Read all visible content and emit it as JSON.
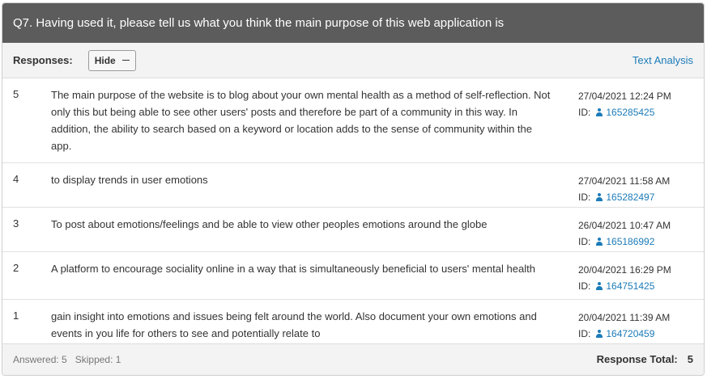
{
  "question": {
    "title": "Q7. Having used it, please tell us what you think the main purpose of this web application is"
  },
  "toolbar": {
    "responses_label": "Responses:",
    "hide_label": "Hide",
    "text_analysis_label": "Text Analysis"
  },
  "responses": [
    {
      "num": "5",
      "text": "The main purpose of the website is to blog about your own mental health as a method of self-reflection. Not only this but being able to see other users' posts and therefore be part of a community in this way. In addition, the ability to search based on a keyword or location adds to the sense of community within the app.",
      "datetime": "27/04/2021 12:24 PM",
      "id_label": "ID:",
      "id": "165285425"
    },
    {
      "num": "4",
      "text": "to display trends in user emotions",
      "datetime": "27/04/2021 11:58 AM",
      "id_label": "ID:",
      "id": "165282497"
    },
    {
      "num": "3",
      "text": "To post about emotions/feelings and be able to view other peoples emotions around the globe",
      "datetime": "26/04/2021 10:47 AM",
      "id_label": "ID:",
      "id": "165186992"
    },
    {
      "num": "2",
      "text": "A platform to encourage sociality online in a way that is simultaneously beneficial to users' mental health",
      "datetime": "20/04/2021 16:29 PM",
      "id_label": "ID:",
      "id": "164751425"
    },
    {
      "num": "1",
      "text": "gain insight into emotions and issues being felt around the world. Also document your own emotions and events in you life for others to see and potentially relate to",
      "datetime": "20/04/2021 11:39 AM",
      "id_label": "ID:",
      "id": "164720459"
    }
  ],
  "footer": {
    "answered": "Answered: 5",
    "skipped": "Skipped: 1",
    "total_label": "Response Total:",
    "total_value": "5"
  }
}
